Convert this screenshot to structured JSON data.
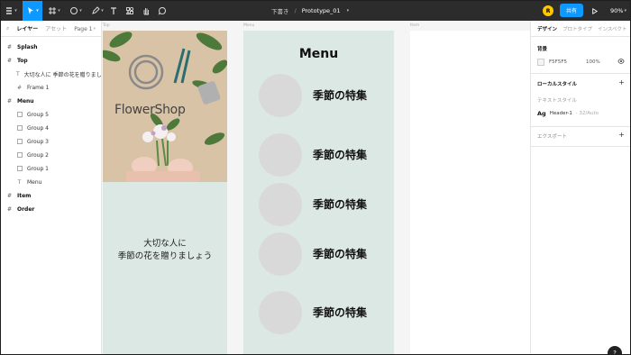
{
  "toolbar": {
    "doc_location": "下書き",
    "doc_sep": "/",
    "doc_name": "Prototype_01",
    "avatar_initial": "R",
    "share_label": "共有",
    "zoom": "90%"
  },
  "left_panel": {
    "tab_layers": "レイヤー",
    "tab_assets": "アセット",
    "page": "Page 1",
    "layers": [
      {
        "label": "Splash",
        "kind": "frame"
      },
      {
        "label": "Top",
        "kind": "frame"
      },
      {
        "label": "大切な人に 季節の花を贈りまし...",
        "kind": "text"
      },
      {
        "label": "Frame 1",
        "kind": "frame-child"
      },
      {
        "label": "Menu",
        "kind": "frame"
      },
      {
        "label": "Group 5",
        "kind": "group"
      },
      {
        "label": "Group 4",
        "kind": "group"
      },
      {
        "label": "Group 3",
        "kind": "group"
      },
      {
        "label": "Group 2",
        "kind": "group"
      },
      {
        "label": "Group 1",
        "kind": "group"
      },
      {
        "label": "Menu",
        "kind": "text"
      },
      {
        "label": "Item",
        "kind": "frame"
      },
      {
        "label": "Order",
        "kind": "frame"
      }
    ]
  },
  "canvas": {
    "frame_labels": {
      "top": "Top",
      "menu": "Menu",
      "item": "Item"
    },
    "top_frame": {
      "brand": "FlowerShop",
      "tagline_1": "大切な人に",
      "tagline_2": "季節の花を贈りましょう"
    },
    "menu_frame": {
      "title": "Menu",
      "items": [
        "季節の特集",
        "季節の特集",
        "季節の特集",
        "季節の特集",
        "季節の特集"
      ]
    }
  },
  "right_panel": {
    "tabs": [
      "デザイン",
      "プロトタイプ",
      "インスペクト"
    ],
    "background_title": "背景",
    "bg_hex": "F5F5F5",
    "bg_opacity": "100%",
    "local_styles_title": "ローカルスタイル",
    "text_styles_label": "テキストスタイル",
    "text_style_glyph": "Ag",
    "text_style_name": "Header-1",
    "text_style_meta": "· 32/Auto",
    "export_title": "エクスポート"
  },
  "help_label": "?",
  "colors": {
    "accent": "#0d99ff",
    "toolbar": "#2c2c2c",
    "frame_bg": "#dce8e3",
    "canvas": "#f5f5f5"
  }
}
